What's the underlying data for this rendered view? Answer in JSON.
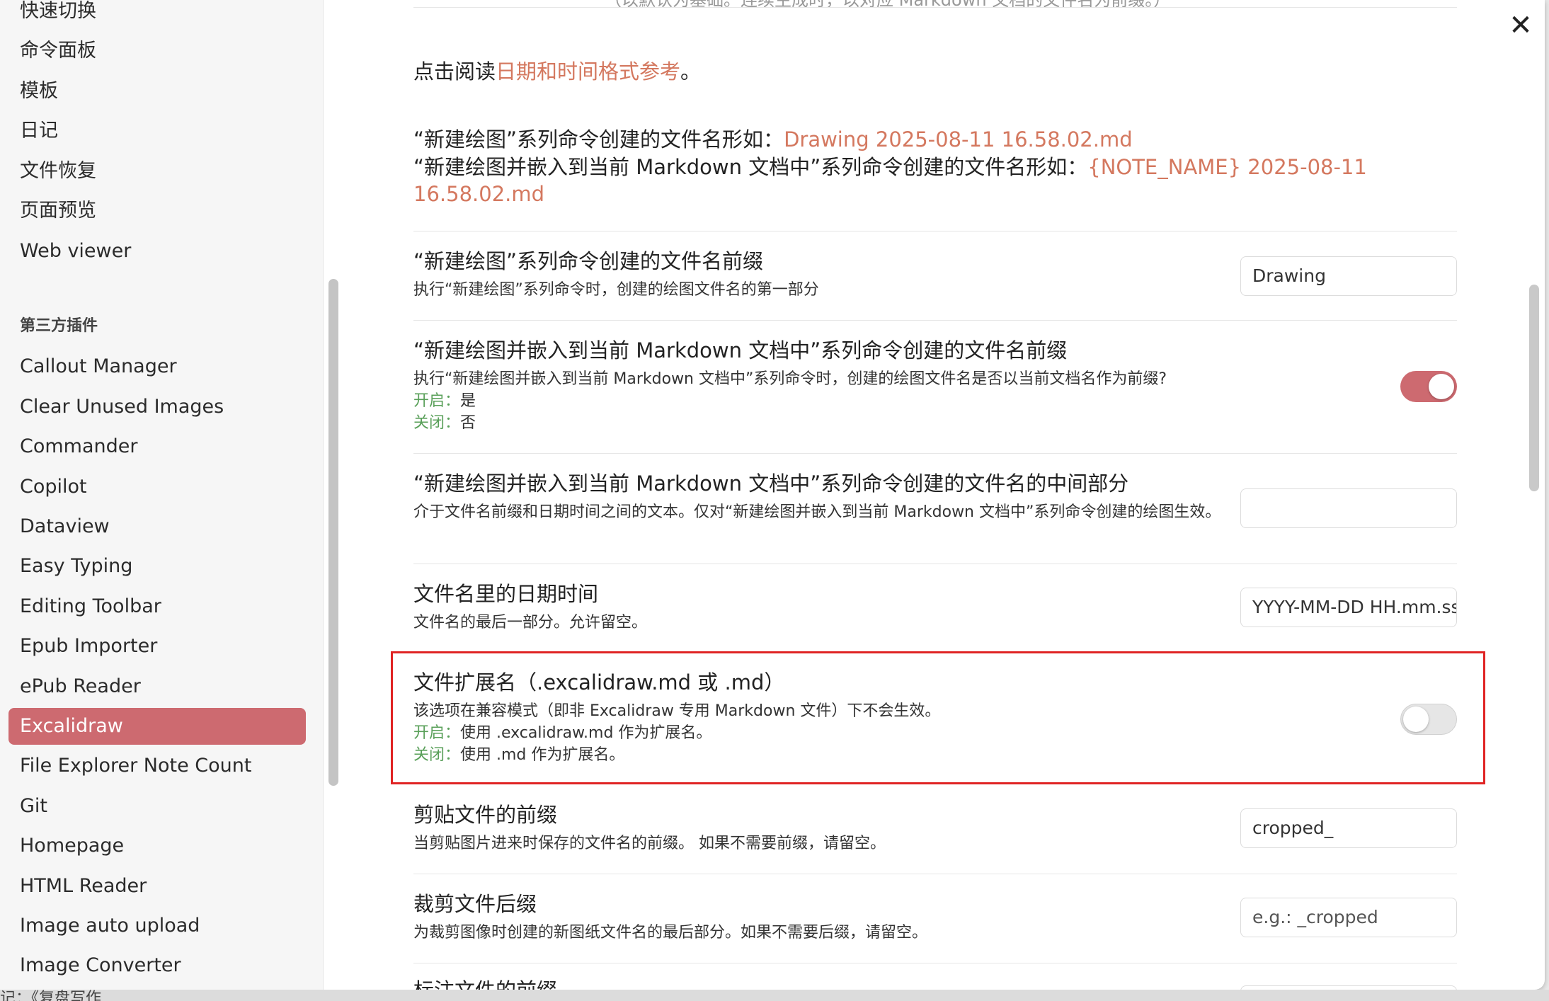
{
  "sidebar": {
    "core_items": [
      "快速切换",
      "命令面板",
      "模板",
      "日记",
      "文件恢复",
      "页面预览",
      "Web viewer"
    ],
    "section_heading": "第三方插件",
    "plugin_items": [
      "Callout Manager",
      "Clear Unused Images",
      "Commander",
      "Copilot",
      "Dataview",
      "Easy Typing",
      "Editing Toolbar",
      "Epub Importer",
      "ePub Reader",
      "Excalidraw",
      "File Explorer Note Count",
      "Git",
      "Homepage",
      "HTML Reader",
      "Image auto upload",
      "Image Converter"
    ],
    "active_item": "Excalidraw"
  },
  "close_icon": "✕",
  "content": {
    "cut_top_text": "（以默认为基础。连续生成时，以对应 Markdown 文档的文件名为前缀。）",
    "intro_prefix": "点击阅读",
    "intro_link": "日期和时间格式参考",
    "intro_suffix": "。",
    "example1_prefix": "“新建绘图”系列命令创建的文件名形如：",
    "example1_value": "Drawing 2025-08-11 16.58.02.md",
    "example2_prefix": "“新建绘图并嵌入到当前 Markdown 文档中”系列命令创建的文件名形如：",
    "example2_value": "{NOTE_NAME} 2025-08-11 16.58.02.md",
    "settings": [
      {
        "title": "“新建绘图”系列命令创建的文件名前缀",
        "desc": "执行“新建绘图”系列命令时，创建的绘图文件名的第一部分",
        "value": "Drawing"
      },
      {
        "title": "“新建绘图并嵌入到当前 Markdown 文档中”系列命令创建的文件名前缀",
        "desc": "执行“新建绘图并嵌入到当前 Markdown 文档中”系列命令时，创建的绘图文件名是否以当前文档名作为前缀?",
        "on_label": "开启：",
        "on_text": "是",
        "off_label": "关闭：",
        "off_text": "否"
      },
      {
        "title": "“新建绘图并嵌入到当前 Markdown 文档中”系列命令创建的文件名的中间部分",
        "desc": "介于文件名前缀和日期时间之间的文本。仅对“新建绘图并嵌入到当前 Markdown 文档中”系列命令创建的绘图生效。",
        "value": ""
      },
      {
        "title": "文件名里的日期时间",
        "desc": "文件名的最后一部分。允许留空。",
        "value": "YYYY-MM-DD HH.mm.ss"
      },
      {
        "title": "文件扩展名（.excalidraw.md 或 .md）",
        "desc": "该选项在兼容模式（即非 Excalidraw 专用 Markdown 文件）下不会生效。",
        "on_label": "开启：",
        "on_text": "使用 .excalidraw.md 作为扩展名。",
        "off_label": "关闭：",
        "off_text": "使用 .md 作为扩展名。"
      },
      {
        "title": "剪贴文件的前缀",
        "desc": "当剪贴图片进来时保存的文件名的前缀。 如果不需要前缀，请留空。",
        "value": "cropped_"
      },
      {
        "title": "裁剪文件后缀",
        "desc": "为裁剪图像时创建的新图纸文件名的最后部分。如果不需要后缀，请留空。",
        "placeholder": "e.g.: _cropped"
      },
      {
        "title": "标注文件的前缀"
      }
    ]
  },
  "bottom_text": "记：《复盘写作...",
  "colors": {
    "accent": "#cd6a70",
    "link": "#d4785f",
    "on_off_label": "#5aa05a",
    "highlight": "#e02424"
  }
}
